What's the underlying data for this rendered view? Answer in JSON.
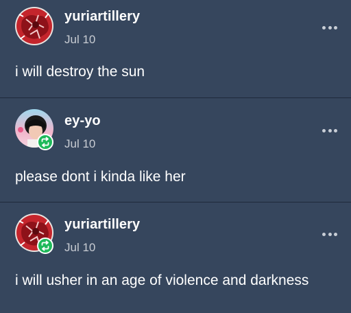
{
  "posts": [
    {
      "username": "yuriartillery",
      "date": "Jul 10",
      "text": "i will destroy the sun",
      "avatar": "red-illustration-avatar",
      "reblog": false
    },
    {
      "username": "ey-yo",
      "date": "Jul 10",
      "text": "please dont i kinda like her",
      "avatar": "person-pink-sky-avatar",
      "reblog": true
    },
    {
      "username": "yuriartillery",
      "date": "Jul 10",
      "text": "i will usher in an age of violence and darkness",
      "avatar": "red-illustration-avatar",
      "reblog": true
    }
  ],
  "icons": {
    "reblog": "reblog-icon",
    "more": "more-options-icon"
  },
  "colors": {
    "background": "#36465d",
    "divider": "#1f2a3a",
    "reblog_badge": "#1fb95a",
    "date_text": "#c8ccd3"
  }
}
